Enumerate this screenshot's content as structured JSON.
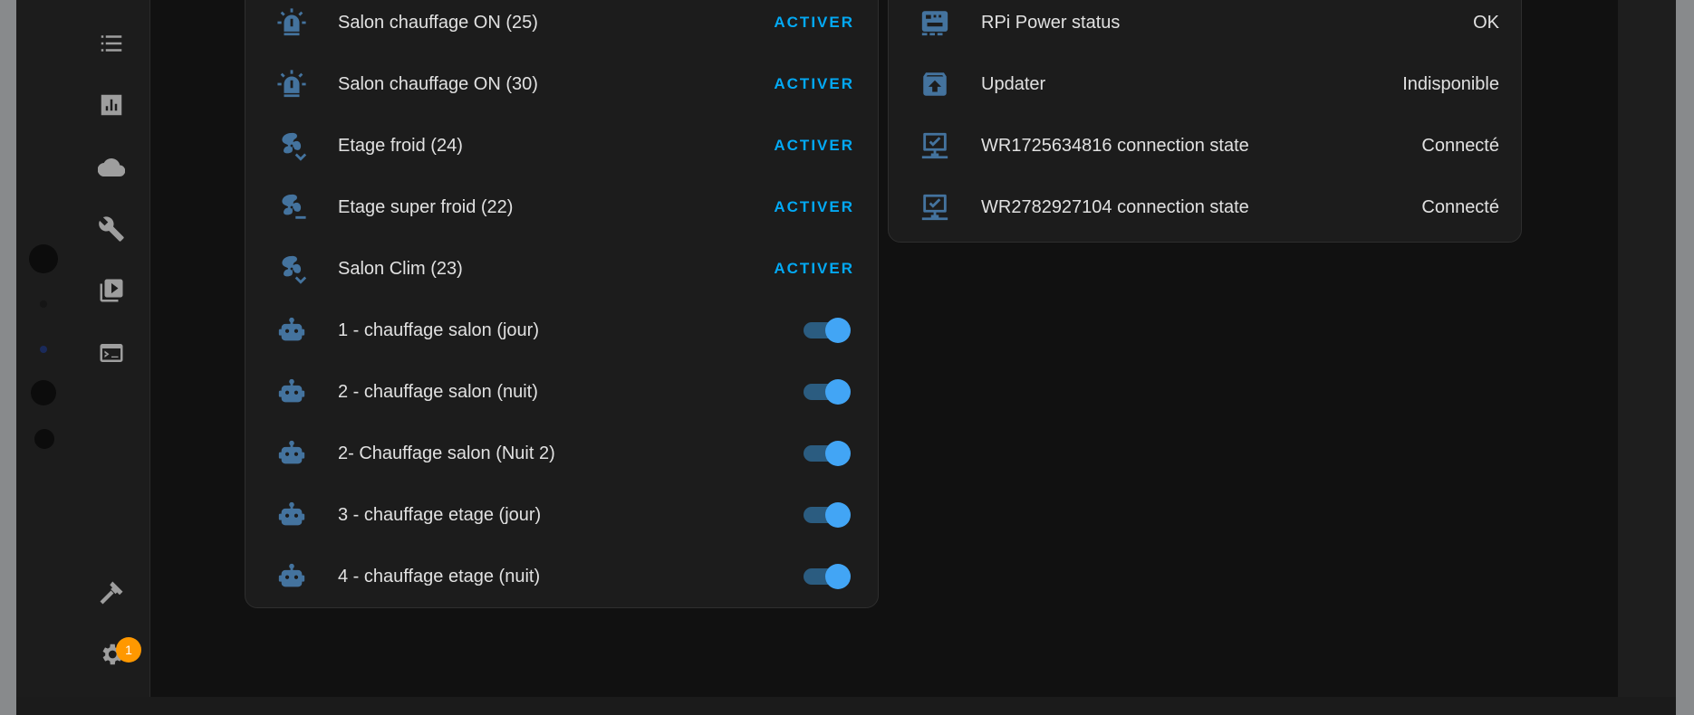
{
  "left_card": {
    "rows": [
      {
        "icon": "alarm-light-icon",
        "label": "Salon chauffage ON (25)",
        "action": "ACTIVER"
      },
      {
        "icon": "alarm-light-icon",
        "label": "Salon chauffage ON (30)",
        "action": "ACTIVER"
      },
      {
        "icon": "fan-chevron-icon",
        "label": "Etage froid (24)",
        "action": "ACTIVER"
      },
      {
        "icon": "fan-minus-icon",
        "label": "Etage super froid (22)",
        "action": "ACTIVER"
      },
      {
        "icon": "fan-chevron-icon",
        "label": "Salon Clim (23)",
        "action": "ACTIVER"
      },
      {
        "icon": "robot-icon",
        "label": "1 - chauffage salon (jour)",
        "toggle": true
      },
      {
        "icon": "robot-icon",
        "label": "2 - chauffage salon (nuit)",
        "toggle": true
      },
      {
        "icon": "robot-icon",
        "label": "2- Chauffage salon (Nuit 2)",
        "toggle": true
      },
      {
        "icon": "robot-icon",
        "label": "3 - chauffage etage (jour)",
        "toggle": true
      },
      {
        "icon": "robot-icon",
        "label": "4 - chauffage etage (nuit)",
        "toggle": true
      }
    ]
  },
  "right_card": {
    "rows": [
      {
        "icon": "raspberry-pi-icon",
        "label": "RPi Power status",
        "value": "OK"
      },
      {
        "icon": "package-up-icon",
        "label": "Updater",
        "value": "Indisponible"
      },
      {
        "icon": "lan-check-icon",
        "label": "WR1725634816 connection state",
        "value": "Connecté"
      },
      {
        "icon": "lan-check-icon",
        "label": "WR2782927104 connection state",
        "value": "Connecté"
      }
    ]
  },
  "sidebar": {
    "items": [
      "logbook-icon",
      "history-icon",
      "cloud-icon",
      "wrench-icon",
      "media-icon",
      "terminal-icon"
    ],
    "bottom": [
      "hammer-icon",
      "settings-icon"
    ],
    "settings_badge": "1"
  },
  "colors": {
    "accent": "#03a9f4",
    "toggle_on": "#42a5f5",
    "icon": "#44739e",
    "badge": "#ff9800"
  }
}
